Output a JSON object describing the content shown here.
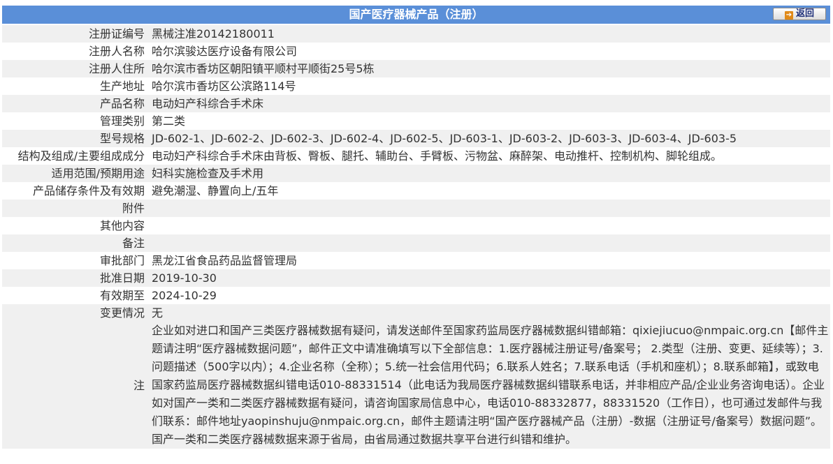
{
  "header": {
    "title": "国产医疗器械产品（注册）",
    "back_label": "返回"
  },
  "rows": [
    {
      "label": "注册证编号",
      "value": "黑械注准20142180011"
    },
    {
      "label": "注册人名称",
      "value": "哈尔滨骏达医疗设备有限公司"
    },
    {
      "label": "注册人住所",
      "value": "哈尔滨市香坊区朝阳镇平顺村平顺街25号5栋"
    },
    {
      "label": "生产地址",
      "value": "哈尔滨市香坊区公滨路114号"
    },
    {
      "label": "产品名称",
      "value": "电动妇产科综合手术床"
    },
    {
      "label": "管理类别",
      "value": "第二类"
    },
    {
      "label": "型号规格",
      "value": "JD-602-1、JD-602-2、JD-602-3、JD-602-4、JD-602-5、JD-603-1、JD-603-2、JD-603-3、JD-603-4、JD-603-5"
    },
    {
      "label": "结构及组成/主要组成成分",
      "value": "电动妇产科综合手术床由背板、臀板、腿托、辅助台、手臂板、污物盆、麻醉架、电动推杆、控制机构、脚轮组成。"
    },
    {
      "label": "适用范围/预期用途",
      "value": "妇科实施检查及手术用"
    },
    {
      "label": "产品储存条件及有效期",
      "value": "避免潮湿、静置向上/五年"
    },
    {
      "label": "附件",
      "value": ""
    },
    {
      "label": "其他内容",
      "value": ""
    },
    {
      "label": "备注",
      "value": ""
    },
    {
      "label": "审批部门",
      "value": "黑龙江省食品药品监督管理局"
    },
    {
      "label": "批准日期",
      "value": "2019-10-30"
    },
    {
      "label": "有效期至",
      "value": "2024-10-29"
    },
    {
      "label": "变更情况",
      "value": "无"
    }
  ],
  "note": {
    "label": "注",
    "text": "企业如对进口和国产三类医疗器械数据有疑问，请发送邮件至国家药监局医疗器械数据纠错邮箱：qixiejiucuo@nmpaic.org.cn【邮件主题请注明“医疗器械数据问题”，邮件正文中请准确填写以下全部信息：1.医疗器械注册证号/备案号； 2.类型（注册、变更、延续等）；3.问题描述（500字以内）；4.企业名称（全称）；5.统一社会信用代码；6.联系人姓名；7.联系电话（手机和座机）；8.联系邮箱】，或致电国家药监局医疗器械数据纠错电话010-88331514（此电话为我局医疗器械数据纠错联系电话，并非相应产品/企业业务咨询电话）。企业如对国产一类和二类医疗器械数据有疑问，请咨询国家局信息中心，电话010-88332877，88331520（工作日），也可通过发邮件与我们联系：邮件地址yaopinshuju@nmpaic.org.cn，邮件主题请注明“国产医疗器械产品（注册）-数据（注册证号/备案号）数据问题”。国产一类和二类医疗器械数据来源于省局，由省局通过数据共享平台进行纠错和维护。"
  }
}
